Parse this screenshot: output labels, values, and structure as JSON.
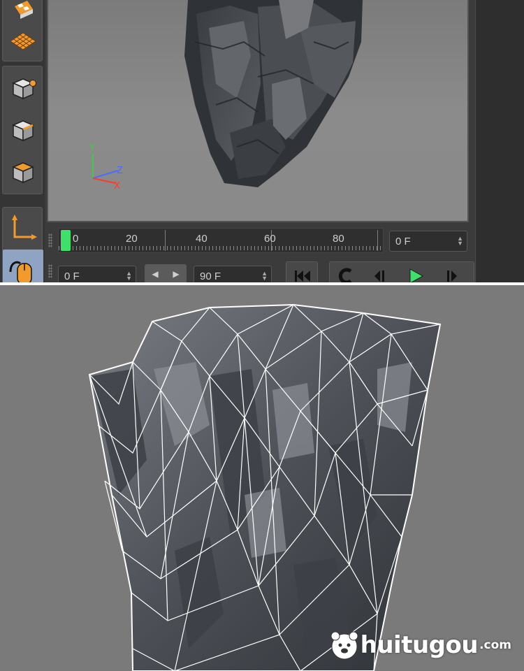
{
  "toolbar": {
    "tools": [
      {
        "name": "checker-texture-icon"
      },
      {
        "name": "grid-plane-icon"
      },
      {
        "name": "point-mode-icon"
      },
      {
        "name": "edge-mode-icon"
      },
      {
        "name": "polygon-mode-icon"
      },
      {
        "name": "axis-mode-icon"
      },
      {
        "name": "mouse-tweak-icon",
        "active": true
      }
    ]
  },
  "viewport": {
    "axis_gizmo": {
      "y": "Y",
      "z": "Z",
      "x": "X"
    }
  },
  "timeline": {
    "ruler_labels": [
      "0",
      "20",
      "40",
      "60",
      "80"
    ],
    "current_frame": "0 F",
    "start_frame": "0 F",
    "end_frame": "90 F"
  },
  "transport": {
    "buttons": [
      "go-to-start",
      "record-key",
      "previous-frame",
      "play",
      "next-frame"
    ]
  },
  "watermark": {
    "logo_text": "huitugou",
    "suffix": ".com"
  },
  "colors": {
    "accent_orange": "#f39a2c",
    "play_green": "#3fe06a",
    "active_tool": "#8fa4c2"
  }
}
